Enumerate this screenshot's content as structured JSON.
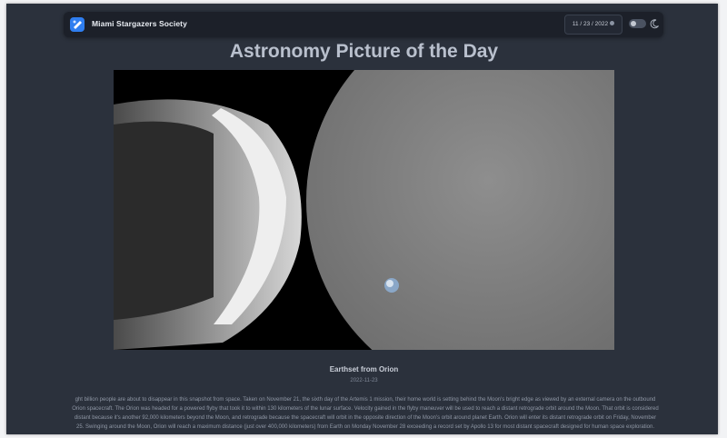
{
  "site": {
    "name": "Miami Stargazers Society",
    "logo_icon": "telescope-logo-icon"
  },
  "header": {
    "date_value": "11 / 23 / 2022",
    "date_icon": "calendar-icon",
    "theme_toggle_icon": "moon-icon",
    "dark_mode": false
  },
  "page": {
    "title": "Astronomy Picture of the Day"
  },
  "apod": {
    "caption": "Earthset from Orion",
    "date": "2022-11-23",
    "explanation": "ght billion people are about to disappear in this snapshot from space. Taken on November 21, the sixth day of the Artemis 1 mission, their home world is setting behind the Moon's bright edge as viewed by an external camera on the outbound Orion spacecraft. The Orion was headed for a powered flyby that took it to within 130 kilometers of the lunar surface. Velocity gained in the flyby maneuver will be used to reach a distant retrograde orbit around the Moon. That orbit is considered distant because it's another 92,000 kilometers beyond the Moon, and retrograde because the spacecraft will orbit in the opposite direction of the Moon's orbit around planet Earth. Orion will enter its distant retrograde orbit on Friday, November 25. Swinging around the Moon, Orion will reach a maximum distance (just over 400,000 kilometers) from Earth on Monday November 28 exceeding a record set by Apollo 13 for most distant spacecraft designed for human space exploration."
  },
  "colors": {
    "background": "#2b313c",
    "navbar": "#1c2029",
    "accent": "#2f7ef0"
  }
}
